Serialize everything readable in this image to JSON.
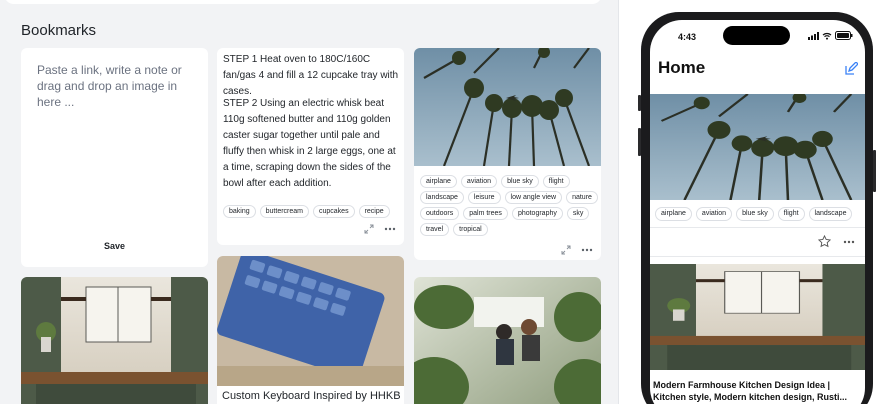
{
  "bookmarks": {
    "title": "Bookmarks",
    "compose": {
      "placeholder": "Paste a link, write a note or drag and drop an image in here ...",
      "save_label": "Save"
    },
    "note_card": {
      "step1": "STEP 1 Heat oven to 180C/160C fan/gas 4 and fill a 12 cupcake tray with cases.",
      "step2": "STEP 2 Using an electric whisk beat 110g softened butter and 110g golden caster sugar together until pale and fluffy then whisk in 2 large eggs, one at a time, scraping down the sides of the bowl after each addition.",
      "tags": [
        "baking",
        "buttercream",
        "cupcakes",
        "recipe"
      ]
    },
    "photo_card": {
      "tags": [
        "airplane",
        "aviation",
        "blue sky",
        "flight",
        "landscape",
        "leisure",
        "low angle view",
        "nature",
        "outdoors",
        "palm trees",
        "photography",
        "sky",
        "travel",
        "tropical"
      ]
    },
    "keyboard_card": {
      "caption": "Custom Keyboard Inspired by HHKB"
    }
  },
  "mobile": {
    "time": "4:43",
    "title": "Home",
    "tags": [
      "airplane",
      "aviation",
      "blue sky",
      "flight",
      "landscape"
    ],
    "caption": "Modern Farmhouse Kitchen Design Idea | Kitchen style, Modern kitchen design, Rusti..."
  },
  "colors": {
    "page_bg": "#f2f3f5",
    "accent": "#3b82f6"
  },
  "icons": {
    "expand": "expand-icon",
    "more": "more-icon",
    "star": "star-icon",
    "edit": "compose-icon"
  }
}
